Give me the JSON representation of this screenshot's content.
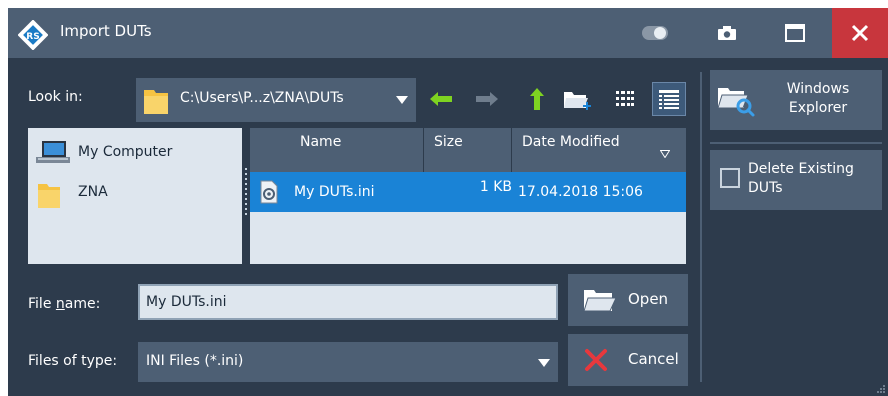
{
  "window": {
    "title": "Import DUTs",
    "controls": [
      "toggle-icon",
      "camera-icon",
      "maximize-icon",
      "close-icon"
    ],
    "colors": {
      "titlebar": "#4d5f74",
      "body": "#2d3b4c",
      "close": "#c8363d",
      "selection": "#1a83d6"
    }
  },
  "look_in": {
    "label": "Look in:",
    "path": "C:\\Users\\P...z\\ZNA\\DUTs"
  },
  "toolbar": {
    "icons": [
      "back-arrow-icon",
      "forward-arrow-icon",
      "up-arrow-icon",
      "new-folder-icon",
      "list-view-icon",
      "details-view-icon"
    ]
  },
  "places": [
    {
      "label": "My Computer",
      "icon": "computer-icon"
    },
    {
      "label": "ZNA",
      "icon": "folder-icon"
    }
  ],
  "file_list": {
    "columns": [
      "Name",
      "Size",
      "Date Modified"
    ],
    "rows": [
      {
        "name": "My DUTs.ini",
        "size": "1 KB",
        "date": "17.04.2018 15:06",
        "selected": true
      }
    ]
  },
  "file_name": {
    "label": "File name:",
    "value": "My DUTs.ini"
  },
  "file_type": {
    "label": "Files of type:",
    "value": "INI Files (*.ini)"
  },
  "buttons": {
    "open": "Open",
    "cancel": "Cancel",
    "windows_explorer": "Windows Explorer"
  },
  "delete_existing": {
    "label": "Delete Existing DUTs",
    "checked": false
  }
}
